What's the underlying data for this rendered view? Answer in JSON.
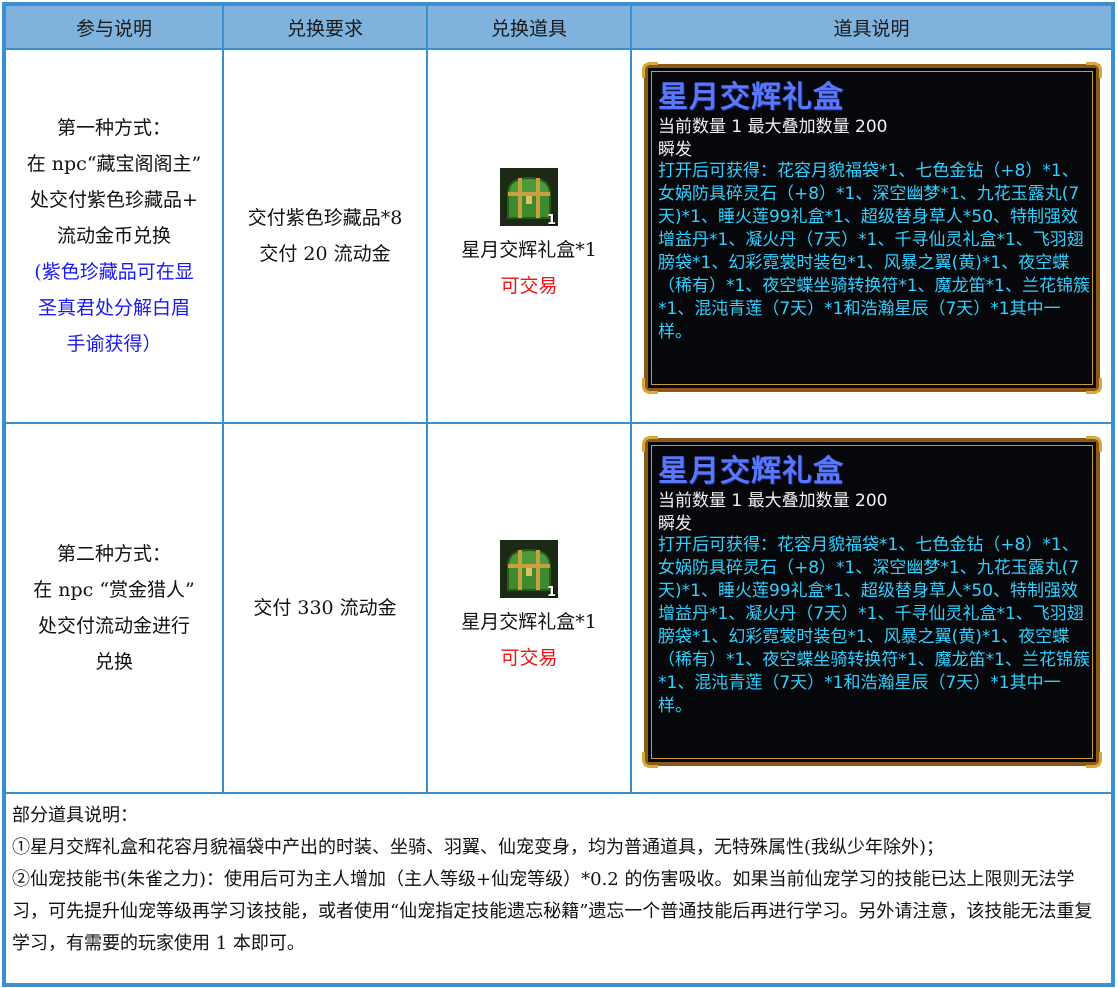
{
  "headers": [
    "参与说明",
    "兑换要求",
    "兑换道具",
    "道具说明"
  ],
  "rows": [
    {
      "method_lines": [
        "第一种方式：",
        "在 npc“藏宝阁阁主”",
        "处交付紫色珍藏品+",
        "流动金币兑换"
      ],
      "method_note_lines": [
        "(紫色珍藏品可在显",
        "圣真君处分解白眉",
        "手谕获得）"
      ],
      "requirement_lines": [
        "交付紫色珍藏品*8",
        "交付 20 流动金"
      ],
      "item_name": "星月交辉礼盒*1",
      "item_tradable": "可交易",
      "item_count": "1"
    },
    {
      "method_lines": [
        "第二种方式：",
        "在 npc “赏金猎人”",
        "处交付流动金进行",
        "兑换"
      ],
      "method_note_lines": [],
      "requirement_lines": [
        "交付 330 流动金"
      ],
      "item_name": "星月交辉礼盒*1",
      "item_tradable": "可交易",
      "item_count": "1"
    }
  ],
  "tooltip": {
    "title": "星月交辉礼盒",
    "line1": "当前数量 1 最大叠加数量 200",
    "line2": "瞬发",
    "description": "打开后可获得：花容月貌福袋*1、七色金钻（+8）*1、女娲防具碎灵石（+8）*1、深空幽梦*1、九花玉露丸(7天)*1、睡火莲99礼盒*1、超级替身草人*50、特制强效增益丹*1、凝火丹（7天）*1、千寻仙灵礼盒*1、飞羽翅膀袋*1、幻彩霓裳时装包*1、风暴之翼(黄)*1、夜空蝶（稀有）*1、夜空蝶坐骑转换符*1、魔龙笛*1、兰花锦簇*1、混沌青莲（7天）*1和浩瀚星辰（7天）*1其中一样。"
  },
  "notes": {
    "heading": "部分道具说明：",
    "item1": "①星月交辉礼盒和花容月貌福袋中产出的时装、坐骑、羽翼、仙宠变身，均为普通道具，无特殊属性(我纵少年除外)；",
    "item2": "②仙宠技能书(朱雀之力)：使用后可为主人增加（主人等级+仙宠等级）*0.2 的伤害吸收。如果当前仙宠学习的技能已达上限则无法学习，可先提升仙宠等级再学习该技能，或者使用“仙宠指定技能遗忘秘籍”遗忘一个普通技能后再进行学习。另外请注意，该技能无法重复学习，有需要的玩家使用 1 本即可。"
  },
  "colors": {
    "header_bg": "#7fb2dc",
    "border": "#3a8fd0",
    "note_blue": "#1a1aee",
    "tradable_red": "#ee1111",
    "tooltip_title": "#5a78ff",
    "tooltip_desc": "#33d0ff"
  },
  "icons": {
    "item_icon": "treasure-chest-icon"
  }
}
